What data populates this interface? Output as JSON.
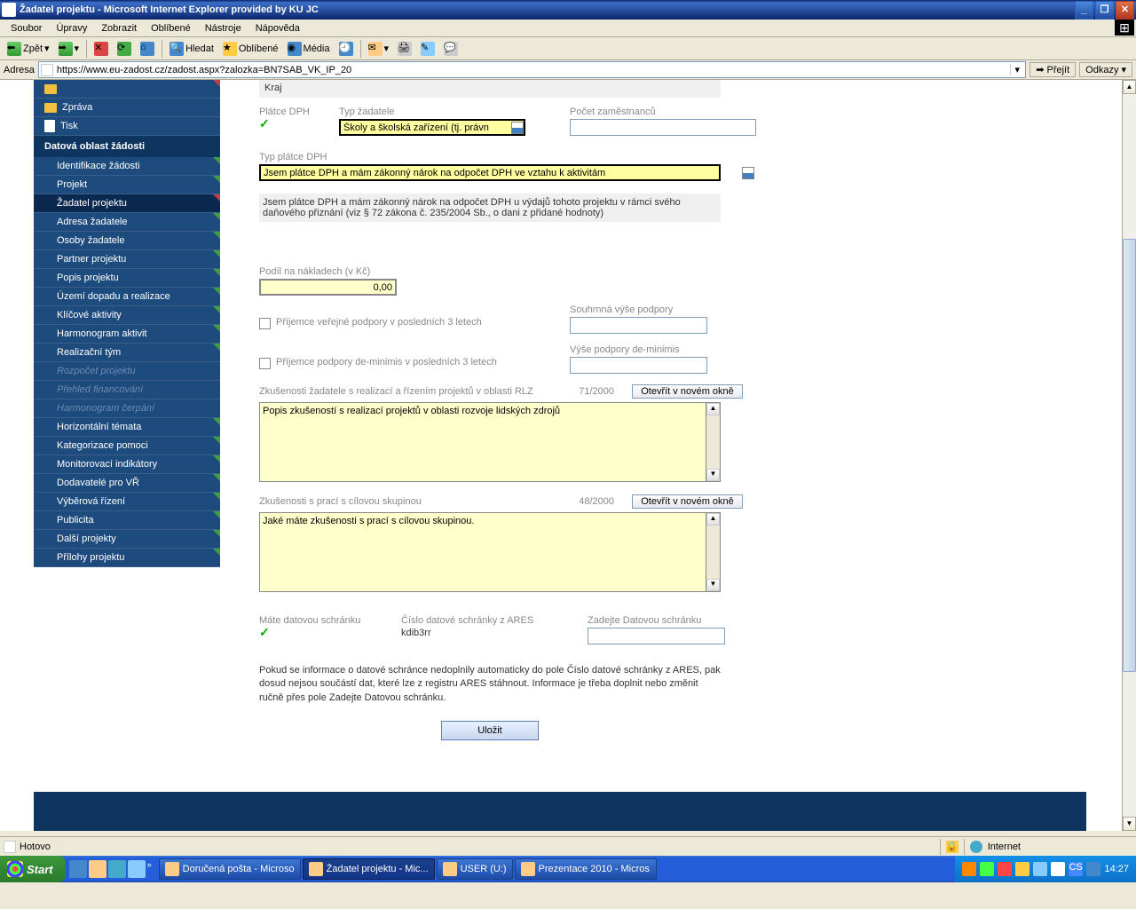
{
  "window": {
    "title": "Žadatel projektu - Microsoft Internet Explorer provided by KU JC"
  },
  "menubar": [
    "Soubor",
    "Úpravy",
    "Zobrazit",
    "Oblíbené",
    "Nástroje",
    "Nápověda"
  ],
  "toolbar": {
    "back": "Zpět",
    "search": "Hledat",
    "favorites": "Oblíbené",
    "media": "Média"
  },
  "address": {
    "label": "Adresa",
    "url": "https://www.eu-zadost.cz/zadost.aspx?zalozka=BN7SAB_VK_IP_20",
    "go": "Přejít",
    "links": "Odkazy"
  },
  "sidebar": {
    "top": [
      {
        "label": "",
        "icon": "folder"
      },
      {
        "label": "Zpráva",
        "icon": "folder"
      },
      {
        "label": "Tisk",
        "icon": "doc"
      }
    ],
    "header": "Datová oblast žádosti",
    "items": [
      {
        "label": "Identifikace žádosti",
        "marker": "green"
      },
      {
        "label": "Projekt",
        "marker": "green"
      },
      {
        "label": "Žadatel projektu",
        "active": true,
        "marker": "red"
      },
      {
        "label": "Adresa žadatele",
        "marker": "green"
      },
      {
        "label": "Osoby žadatele",
        "marker": "green"
      },
      {
        "label": "Partner projektu",
        "marker": "green"
      },
      {
        "label": "Popis projektu",
        "marker": "green"
      },
      {
        "label": "Území dopadu a realizace",
        "marker": "green"
      },
      {
        "label": "Klíčové aktivity",
        "marker": "green"
      },
      {
        "label": "Harmonogram aktivit",
        "marker": "green"
      },
      {
        "label": "Realizační tým",
        "marker": "green"
      },
      {
        "label": "Rozpočet projektu",
        "disabled": true
      },
      {
        "label": "Přehled financování",
        "disabled": true
      },
      {
        "label": "Harmonogram čerpání",
        "disabled": true
      },
      {
        "label": "Horizontální témata",
        "marker": "green"
      },
      {
        "label": "Kategorizace pomoci",
        "marker": "green"
      },
      {
        "label": "Monitorovací indikátory",
        "marker": "green"
      },
      {
        "label": "Dodavatelé pro VŘ",
        "marker": "green"
      },
      {
        "label": "Výběrová řízení",
        "marker": "green"
      },
      {
        "label": "Publicita",
        "marker": "green"
      },
      {
        "label": "Další projekty",
        "marker": "green"
      },
      {
        "label": "Přílohy projektu",
        "marker": "green"
      }
    ]
  },
  "form": {
    "kraj_label": "Kraj",
    "platce_dph_label": "Plátce DPH",
    "typ_zadatele_label": "Typ žadatele",
    "typ_zadatele_value": "Školy a školská zařízení (tj. právn",
    "pocet_zam_label": "Počet zaměstnanců",
    "typ_platce_label": "Typ plátce DPH",
    "typ_platce_value": "Jsem plátce DPH a mám zákonný nárok na odpočet DPH ve vztahu k aktivitám",
    "typ_platce_desc": "Jsem plátce DPH a mám zákonný nárok na odpočet DPH u výdajů tohoto projektu v rámci svého daňového přiznání (viz § 72 zákona č. 235/2004 Sb., o dani z přidané hodnoty)",
    "podil_label": "Podíl na nákladech (v Kč)",
    "podil_value": "0,00",
    "prijemce1_label": "Příjemce veřejné podpory v posledních 3 letech",
    "souhrnna_label": "Souhrnná výše podpory",
    "prijemce2_label": "Příjemce podpory de-minimis v posledních 3 letech",
    "vyse_label": "Výše podpory de-minimis",
    "zkusenosti1_label": "Zkušenosti žadatele s realizací a řízením projektů v oblasti RLZ",
    "zkusenosti1_count": "71/2000",
    "zkusenosti1_value": "Popis zkušeností s realizací projektů v oblasti rozvoje lidských zdrojů",
    "zkusenosti2_label": "Zkušenosti s prací s cílovou skupinou",
    "zkusenosti2_count": "48/2000",
    "zkusenosti2_value": "Jaké máte zkušenosti s prací s cílovou skupinou.",
    "open_new": "Otevřít v novém okně",
    "schranka_label": "Máte datovou schránku",
    "cislo_label": "Číslo datové schránky z ARES",
    "cislo_value": "kdib3rr",
    "zadejte_label": "Zadejte Datovou schránku",
    "info_text": "Pokud se informace o datové schránce nedoplnily automaticky do pole Číslo datové schránky z ARES, pak dosud nejsou součástí dat, které lze z registru ARES stáhnout. Informace je třeba doplnit nebo změnit ručně přes pole Zadejte Datovou schránku.",
    "save": "Uložit"
  },
  "statusbar": {
    "status": "Hotovo",
    "zone": "Internet"
  },
  "taskbar": {
    "start": "Start",
    "tasks": [
      {
        "label": "Doručená pošta - Microso..."
      },
      {
        "label": "Žadatel projektu - Mic...",
        "active": true
      },
      {
        "label": "USER (U:)"
      },
      {
        "label": "Prezentace 2010 - Micros..."
      }
    ],
    "time": "14:27"
  }
}
